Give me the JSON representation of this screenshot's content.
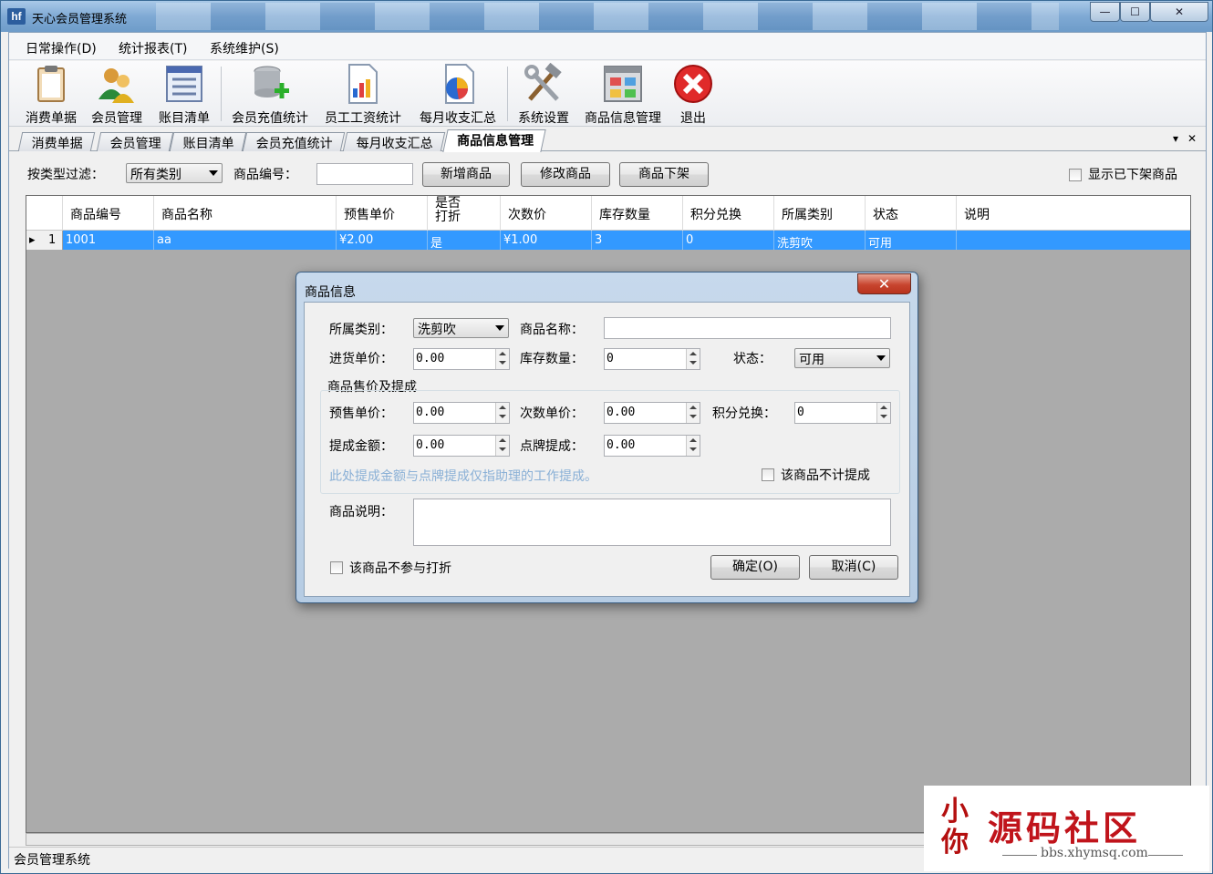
{
  "window": {
    "title": "天心会员管理系统",
    "app_icon_text": "hf",
    "min": "—",
    "max": "☐",
    "close": "✕"
  },
  "menu": [
    {
      "label": "日常操作(D)"
    },
    {
      "label": "统计报表(T)"
    },
    {
      "label": "系统维护(S)"
    }
  ],
  "toolbar": [
    {
      "label": "消费单据",
      "icon": "clipboard-icon"
    },
    {
      "label": "会员管理",
      "icon": "users-icon"
    },
    {
      "label": "账目清单",
      "icon": "list-icon"
    },
    {
      "label": "会员充值统计",
      "icon": "database-add-icon"
    },
    {
      "label": "员工工资统计",
      "icon": "bar-chart-icon"
    },
    {
      "label": "每月收支汇总",
      "icon": "pie-chart-icon"
    },
    {
      "label": "系统设置",
      "icon": "tools-icon"
    },
    {
      "label": "商品信息管理",
      "icon": "window-grid-icon"
    },
    {
      "label": "退出",
      "icon": "exit-icon"
    }
  ],
  "tabs": [
    {
      "label": "消费单据"
    },
    {
      "label": "会员管理"
    },
    {
      "label": "账目清单"
    },
    {
      "label": "会员充值统计"
    },
    {
      "label": "每月收支汇总"
    },
    {
      "label": "商品信息管理",
      "active": true
    }
  ],
  "tab_controls": {
    "dropdown": "▾",
    "close": "✕"
  },
  "filter": {
    "type_label": "按类型过滤：",
    "type_value": "所有类别",
    "code_label": "商品编号：",
    "code_value": "",
    "add_button": "新增商品",
    "edit_button": "修改商品",
    "delist_button": "商品下架",
    "show_delisted_label": "显示已下架商品",
    "show_delisted_checked": false
  },
  "grid": {
    "columns": [
      "商品编号",
      "商品名称",
      "预售单价",
      "是否打折",
      "次数价",
      "库存数量",
      "积分兑换",
      "所属类别",
      "状态",
      "说明"
    ],
    "rows": [
      {
        "index": "1",
        "cells": [
          "1001",
          "aa",
          "¥2.00",
          "是",
          "¥1.00",
          "3",
          "0",
          "洗剪吹",
          "可用",
          ""
        ]
      }
    ],
    "row_marker": "▸"
  },
  "statusbar": {
    "text": "会员管理系统"
  },
  "dialog": {
    "title": "商品信息",
    "close": "✕",
    "category_label": "所属类别：",
    "category_value": "洗剪吹",
    "name_label": "商品名称：",
    "name_value": "",
    "cost_label": "进货单价：",
    "cost_value": "0.00",
    "stock_label": "库存数量：",
    "stock_value": "0",
    "status_label": "状态：",
    "status_value": "可用",
    "group_title": "商品售价及提成",
    "presale_label": "预售单价：",
    "presale_value": "0.00",
    "count_price_label": "次数单价：",
    "count_price_value": "0.00",
    "points_label": "积分兑换：",
    "points_value": "0",
    "commission_label": "提成金额：",
    "commission_value": "0.00",
    "card_commission_label": "点牌提成：",
    "card_commission_value": "0.00",
    "hint": "此处提成金额与点牌提成仅指助理的工作提成。",
    "no_commission_label": "该商品不计提成",
    "desc_label": "商品说明：",
    "desc_value": "",
    "no_discount_label": "该商品不参与打折",
    "ok_button": "确定(O)",
    "cancel_button": "取消(C)"
  },
  "watermark": {
    "seal": "小\n你",
    "title": "源码社区",
    "url": "bbs.xhymsq.com"
  }
}
